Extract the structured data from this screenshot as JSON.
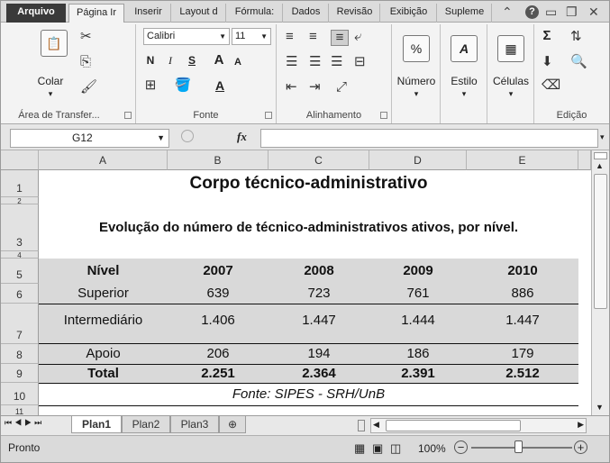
{
  "ribbon_tabs": [
    "Arquivo",
    "Página Ir",
    "Inserir",
    "Layout d",
    "Fórmula:",
    "Dados",
    "Revisão",
    "Exibição",
    "Supleme"
  ],
  "clipboard": {
    "paste_label": "Colar",
    "group_label": "Área de Transfer..."
  },
  "font": {
    "name": "Calibri",
    "size": "11",
    "group_label": "Fonte",
    "bold": "N",
    "italic": "I",
    "underline": "S",
    "grow": "A",
    "shrink": "A",
    "color_a": "A"
  },
  "alignment": {
    "group_label": "Alinhamento"
  },
  "number": {
    "percent": "%",
    "label": "Número"
  },
  "styles": {
    "label": "Estilo"
  },
  "cells": {
    "label": "Células"
  },
  "editing": {
    "group_label": "Edição",
    "sum": "Σ"
  },
  "formula_bar": {
    "name_box": "G12",
    "fx": "fx"
  },
  "columns": [
    "A",
    "B",
    "C",
    "D",
    "E"
  ],
  "rows": [
    "1",
    "2",
    "3",
    "4",
    "5",
    "6",
    "7",
    "8",
    "9",
    "10",
    "11"
  ],
  "sheet": {
    "title": "Corpo técnico-administrativo",
    "subtitle": "Evolução do número de técnico-administrativos ativos, por nível.",
    "header": [
      "Nível",
      "2007",
      "2008",
      "2009",
      "2010"
    ],
    "data_rows": [
      [
        "Superior",
        "639",
        "723",
        "761",
        "886"
      ],
      [
        "Intermediário",
        "1.406",
        "1.447",
        "1.444",
        "1.447"
      ],
      [
        "Apoio",
        "206",
        "194",
        "186",
        "179"
      ]
    ],
    "total": [
      "Total",
      "2.251",
      "2.364",
      "2.391",
      "2.512"
    ],
    "source": "Fonte: SIPES - SRH/UnB"
  },
  "sheet_tabs": [
    "Plan1",
    "Plan2",
    "Plan3"
  ],
  "status": {
    "ready": "Pronto",
    "zoom": "100%"
  }
}
